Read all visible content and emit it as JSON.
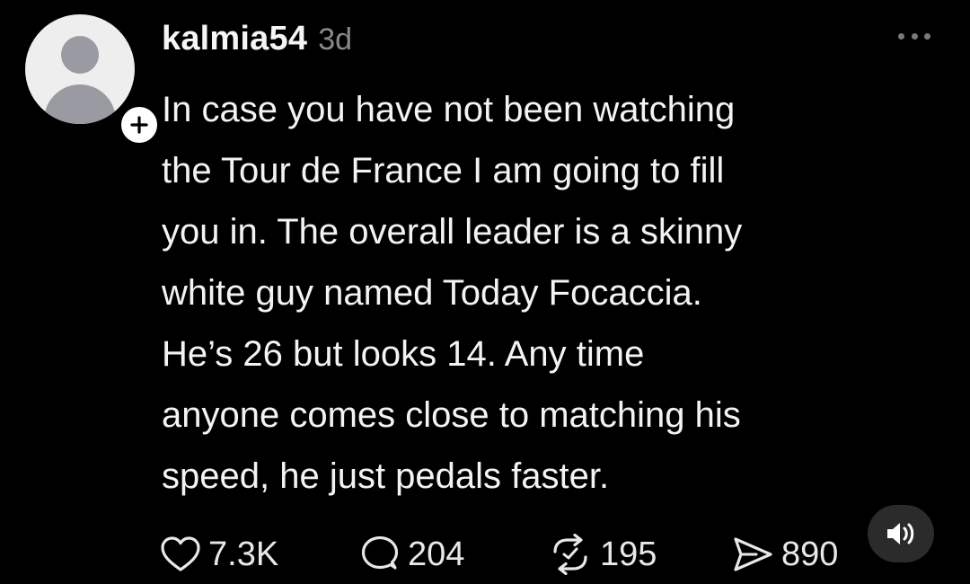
{
  "post": {
    "username": "kalmia54",
    "timestamp": "3d",
    "text_lines": [
      "In case you have not been watching",
      "the Tour de France I am going to fill",
      "you in. The overall leader is a skinny",
      "white guy named Today Focaccia.",
      "He’s 26 but looks 14. Any time",
      "anyone comes close to matching his",
      "speed, he just pedals faster."
    ]
  },
  "actions": {
    "likes": "7.3K",
    "replies": "204",
    "reposts": "195",
    "shares": "890"
  },
  "icons": {
    "avatar": "default-avatar-icon",
    "follow": "plus-icon",
    "more": "more-horizontal-icon",
    "like": "heart-icon",
    "reply": "speech-bubble-icon",
    "repost": "repost-icon",
    "share": "send-icon",
    "audio": "speaker-icon"
  },
  "colors": {
    "background": "#000000",
    "text": "#f3f3f3",
    "muted": "#8a8a8a",
    "audio_button": "#2b2b2b"
  }
}
